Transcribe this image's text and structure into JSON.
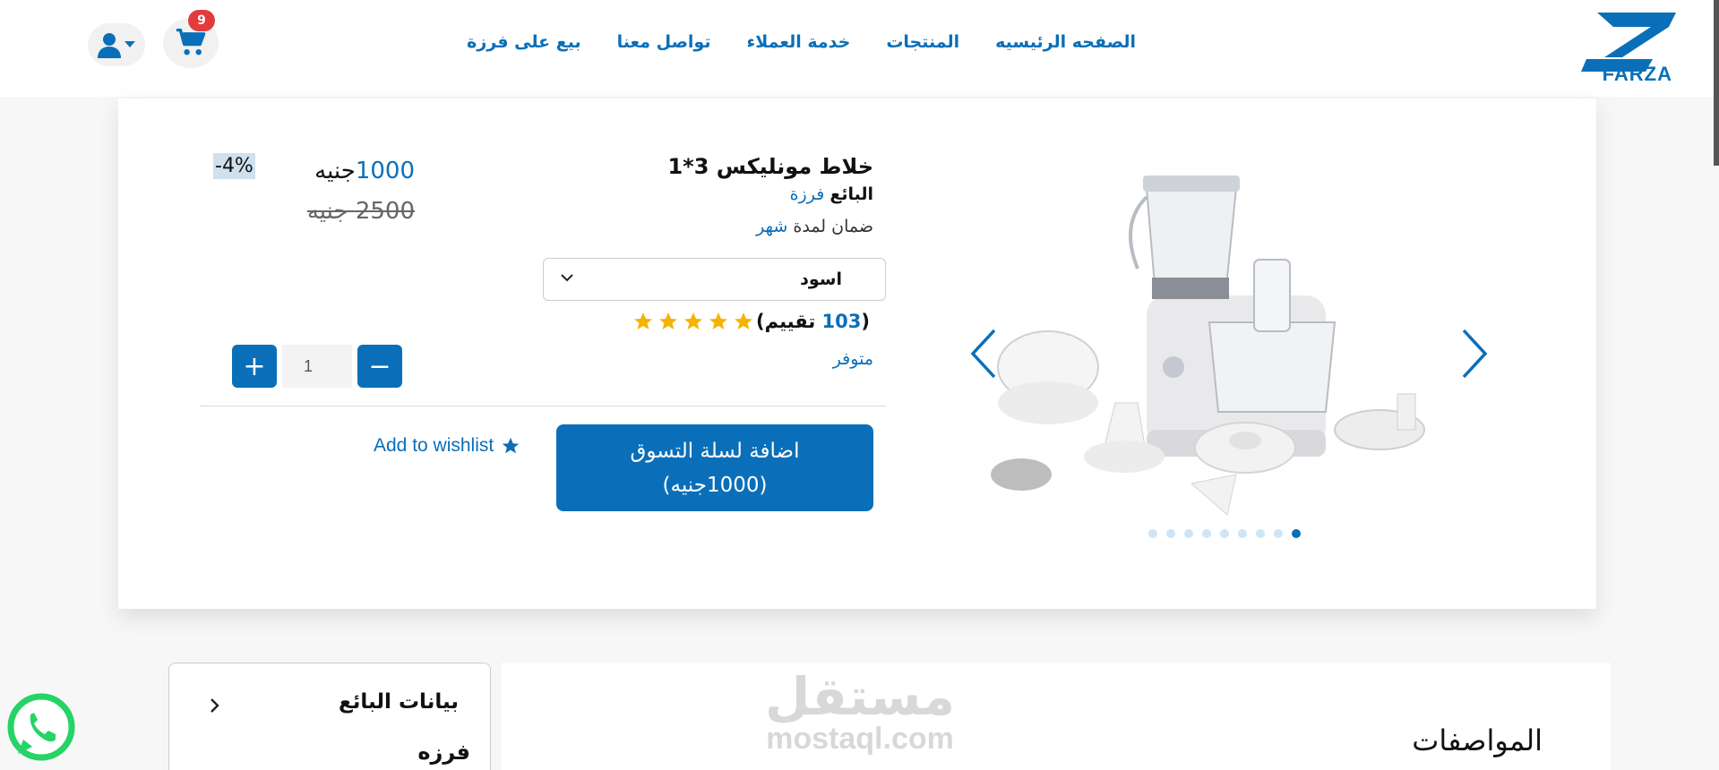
{
  "brand": {
    "logo_text": "FARZA",
    "color": "#0a6fb8"
  },
  "nav": {
    "items": [
      {
        "label": "الصفحه الرئيسيه"
      },
      {
        "label": "المنتجات"
      },
      {
        "label": "خدمة العملاء"
      },
      {
        "label": "تواصل معنا"
      },
      {
        "label": "بيع على فرزة"
      }
    ]
  },
  "header": {
    "cart_count": "9"
  },
  "product": {
    "title": "خلاط مونليكس 3*1",
    "seller_label": "البائع",
    "seller_name": "فرزة",
    "warranty_label": "ضمان لمدة",
    "warranty_value": "شهر",
    "color_option": "اسود",
    "rating_open": "(",
    "rating_count": "103",
    "rating_text": "تقييم)",
    "stars": 5,
    "availability": "متوفر",
    "price_now": "1000",
    "currency": "جنيه",
    "price_old": "2500 جنيه",
    "discount": "-4%",
    "quantity": "1",
    "add_to_cart_line1": "اضافة لسلة التسوق",
    "add_to_cart_line2": "(1000جنيه)",
    "wishlist": "Add to wishlist",
    "gallery_dots": 9,
    "gallery_active_dot": 0
  },
  "seller_box": {
    "heading": "بيانات البائع",
    "name": "فرزه"
  },
  "specs": {
    "heading": "المواصفات"
  },
  "watermark": {
    "ar": "مستقل",
    "en": "mostaql.com"
  },
  "colors": {
    "accent": "#0a6fb8",
    "star": "#f5b301",
    "badge": "#e23b3b"
  }
}
